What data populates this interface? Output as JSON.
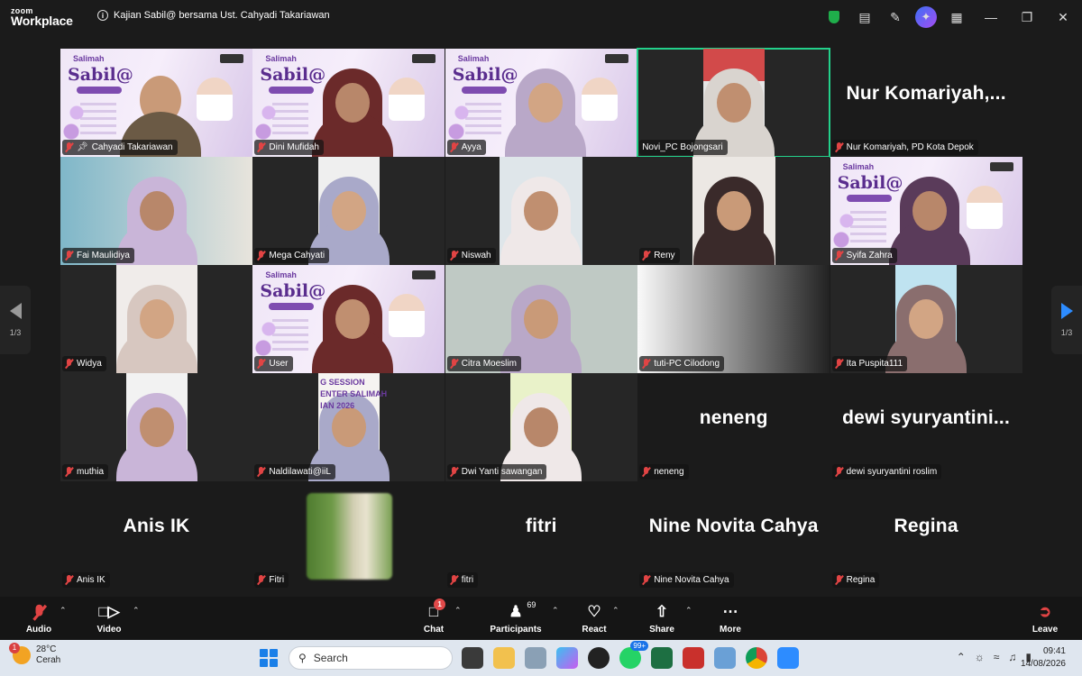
{
  "app": {
    "logo_line1": "zoom",
    "logo_line2": "Workplace",
    "meeting_title": "Kajian Sabil@ bersama Ust. Cahyadi Takariawan",
    "info_icon": "info-icon"
  },
  "titlebar_icons": [
    "shield-icon",
    "notes-icon",
    "annotate-icon",
    "ai-companion-icon",
    "apps-grid-icon",
    "minimize-icon",
    "restore-icon",
    "close-icon"
  ],
  "poster": {
    "brand": "Salimah",
    "title": "Sabil@"
  },
  "tiles": [
    {
      "name": "Cahyadi Takariawan",
      "kind": "poster",
      "pinned": true
    },
    {
      "name": "Dini Mufidah",
      "kind": "poster"
    },
    {
      "name": "Ayya",
      "kind": "poster"
    },
    {
      "name": "Novi_PC Bojongsari",
      "kind": "video",
      "active": true,
      "muted": false
    },
    {
      "name": "Nur Komariyah, PD Kota Depok",
      "kind": "name",
      "display": "Nur Komariyah,..."
    },
    {
      "name": "Fai Maulidiya",
      "kind": "video"
    },
    {
      "name": "Mega Cahyati",
      "kind": "video"
    },
    {
      "name": "Niswah",
      "kind": "video"
    },
    {
      "name": "Reny",
      "kind": "video"
    },
    {
      "name": "Syifa Zahra",
      "kind": "poster"
    },
    {
      "name": "Widya",
      "kind": "video"
    },
    {
      "name": "User",
      "kind": "poster"
    },
    {
      "name": "Citra Moeslim",
      "kind": "video"
    },
    {
      "name": "tuti-PC Cilodong",
      "kind": "video"
    },
    {
      "name": "Ita Puspita111",
      "kind": "video"
    },
    {
      "name": "muthia",
      "kind": "video"
    },
    {
      "name": "Naldilawati@iiL",
      "kind": "video",
      "overlay_text": "G SESSION\nENTER SALIMAH\nIAN 2026"
    },
    {
      "name": "Dwi Yanti sawangan",
      "kind": "video"
    },
    {
      "name": "neneng",
      "kind": "name",
      "display": "neneng"
    },
    {
      "name": "dewi syuryantini roslim",
      "kind": "name",
      "display": "dewi syuryantini..."
    },
    {
      "name": "Anis IK",
      "kind": "name",
      "display": "Anis IK"
    },
    {
      "name": "Fitri",
      "kind": "thumb"
    },
    {
      "name": "fitri",
      "kind": "name",
      "display": "fitri"
    },
    {
      "name": "Nine Novita Cahya",
      "kind": "name",
      "display": "Nine Novita Cahya"
    },
    {
      "name": "Regina",
      "kind": "name",
      "display": "Regina"
    }
  ],
  "pager": {
    "left": "1/3",
    "right": "1/3"
  },
  "toolbar": {
    "audio": "Audio",
    "video": "Video",
    "chat": "Chat",
    "chat_badge": "1",
    "participants": "Participants",
    "participants_count": "69",
    "react": "React",
    "share": "Share",
    "more": "More",
    "leave": "Leave"
  },
  "taskbar": {
    "temp": "28°C",
    "weather": "Cerah",
    "weather_badge": "1",
    "search": "Search",
    "whatsapp_badge": "99+",
    "time": "09:41",
    "date": "14/08/2026"
  },
  "colors": {
    "active_border": "#23d18b",
    "muted_red": "#e14444",
    "share_green": "#1fae4b",
    "pager_blue": "#2d8cff"
  }
}
